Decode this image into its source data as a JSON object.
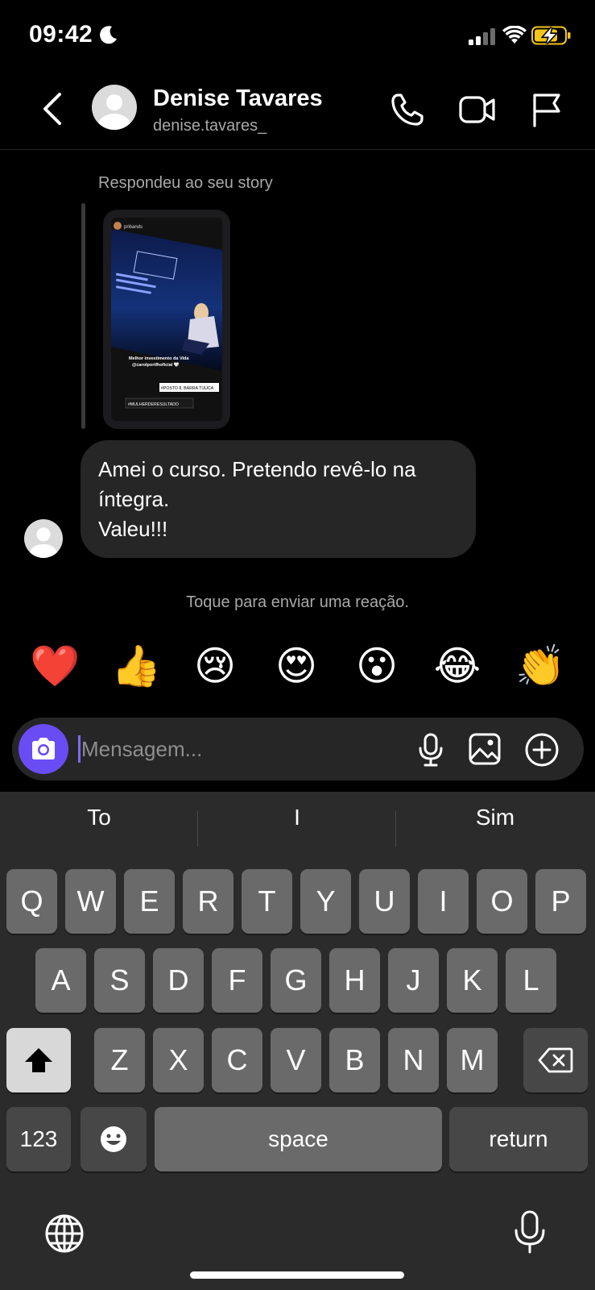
{
  "status_bar": {
    "time": "09:42",
    "icons": [
      "moon-icon",
      "signal-icon",
      "wifi-icon",
      "battery-charging-icon"
    ]
  },
  "header": {
    "name": "Denise Tavares",
    "username": "denise.tavares_",
    "icons": [
      "back-icon",
      "phone-icon",
      "video-icon",
      "flag-icon"
    ]
  },
  "conversation": {
    "story_caption": "Respondeu ao seu story",
    "story_preview": {
      "account": "pribands",
      "caption_line1": "Melhor investimento da Vida",
      "caption_line2": "@carolportfhoficial 🤍",
      "location_tag": "#POSTO 8, BARRA TIJUCA",
      "hashtag": "#MULHERDERESULTADO"
    },
    "message": "Amei o curso. Pretendo revê-lo na íntegra.\nValeu!!!",
    "reaction_hint": "Toque para enviar uma reação.",
    "reactions": [
      "❤️",
      "👍",
      "😢",
      "😍",
      "😮",
      "😂",
      "👏"
    ]
  },
  "composer": {
    "placeholder": "Mensagem...",
    "icons": [
      "camera-icon",
      "mic-icon",
      "gallery-icon",
      "plus-icon"
    ]
  },
  "keyboard": {
    "suggestions": [
      "To",
      "I",
      "Sim"
    ],
    "row1": [
      "Q",
      "W",
      "E",
      "R",
      "T",
      "Y",
      "U",
      "I",
      "O",
      "P"
    ],
    "row2": [
      "A",
      "S",
      "D",
      "F",
      "G",
      "H",
      "J",
      "K",
      "L"
    ],
    "row3": [
      "Z",
      "X",
      "C",
      "V",
      "B",
      "N",
      "M"
    ],
    "numbers_label": "123",
    "space_label": "space",
    "return_label": "return"
  }
}
